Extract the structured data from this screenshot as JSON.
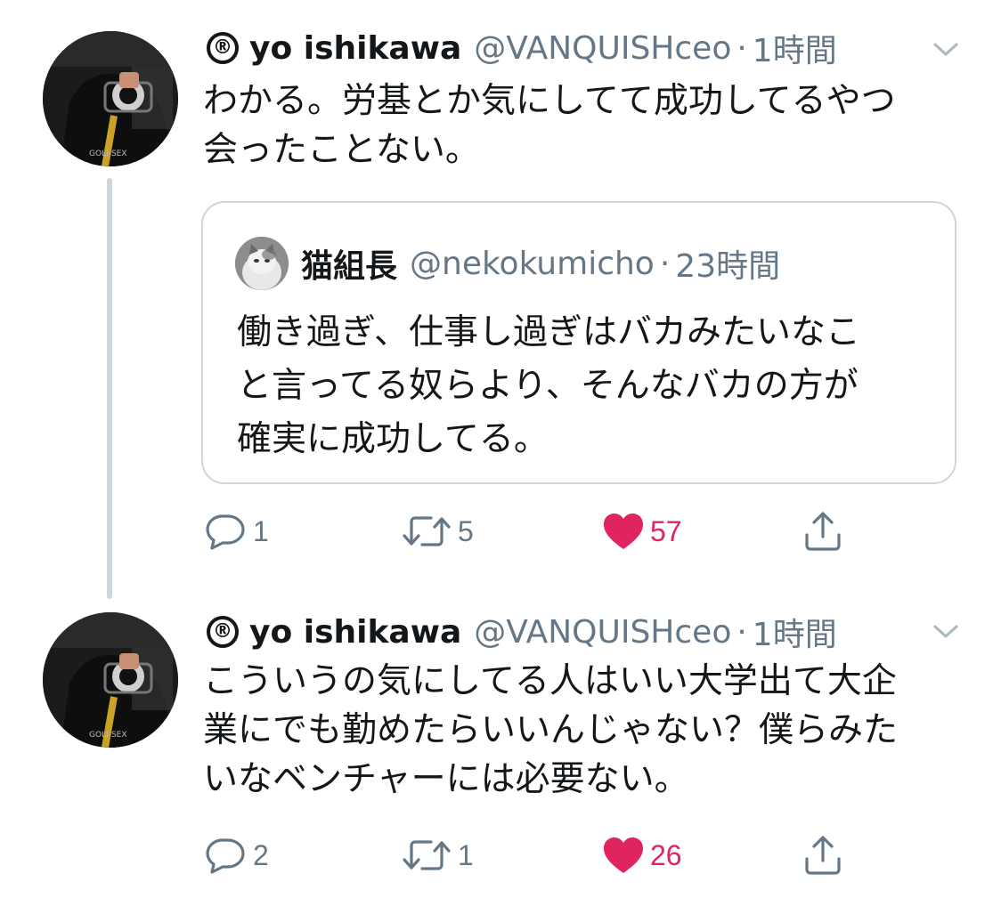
{
  "colors": {
    "text": "#14171a",
    "secondary": "#657786",
    "border": "#ccd6dd",
    "like": "#e0245e"
  },
  "tweets": [
    {
      "reg_mark": "®",
      "display_name": "yo ishikawa",
      "handle": "@VANQUISHceo",
      "separator": "·",
      "time": "1時間",
      "text": "わかる。労基とか気にしてて成功してるやつ\n会ったことない。",
      "quote": {
        "display_name": "猫組長",
        "handle": "@nekokumicho",
        "separator": "·",
        "time": "23時間",
        "text": "働き過ぎ、仕事し過ぎはバカみたいなこ\nと言ってる奴らより、そんなバカの方が\n確実に成功してる。"
      },
      "actions": {
        "reply_count": "1",
        "retweet_count": "5",
        "like_count": "57",
        "liked": true
      }
    },
    {
      "reg_mark": "®",
      "display_name": "yo ishikawa",
      "handle": "@VANQUISHceo",
      "separator": "·",
      "time": "1時間",
      "text": "こういうの気にしてる人はいい大学出て大企\n業にでも勤めたらいいんじゃない？僕らみた\nいなベンチャーには必要ない。",
      "actions": {
        "reply_count": "2",
        "retweet_count": "1",
        "like_count": "26",
        "liked": true
      }
    }
  ],
  "icons": {
    "avatar": "camera-photographer-avatar",
    "quote_avatar": "cat-avatar",
    "caret": "chevron-down-icon",
    "reply": "reply-icon",
    "retweet": "retweet-icon",
    "like": "heart-icon",
    "share": "share-icon"
  }
}
